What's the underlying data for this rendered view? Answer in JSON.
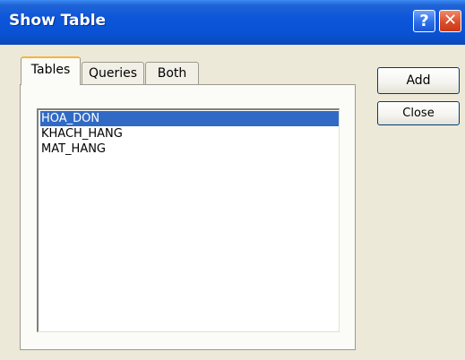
{
  "window": {
    "title": "Show Table",
    "help_glyph": "?",
    "close_glyph": "✕"
  },
  "tabs": [
    {
      "label": "Tables",
      "selected": true
    },
    {
      "label": "Queries",
      "selected": false
    },
    {
      "label": "Both",
      "selected": false
    }
  ],
  "list": {
    "items": [
      "HOA_DON",
      "KHACH_HANG",
      "MAT_HANG"
    ],
    "selected_index": 0
  },
  "buttons": {
    "add_label": "Add",
    "close_label": "Close"
  },
  "colors": {
    "titlebar": "#0952d4",
    "selection": "#316ac5",
    "dialog_face": "#ece9d8"
  }
}
